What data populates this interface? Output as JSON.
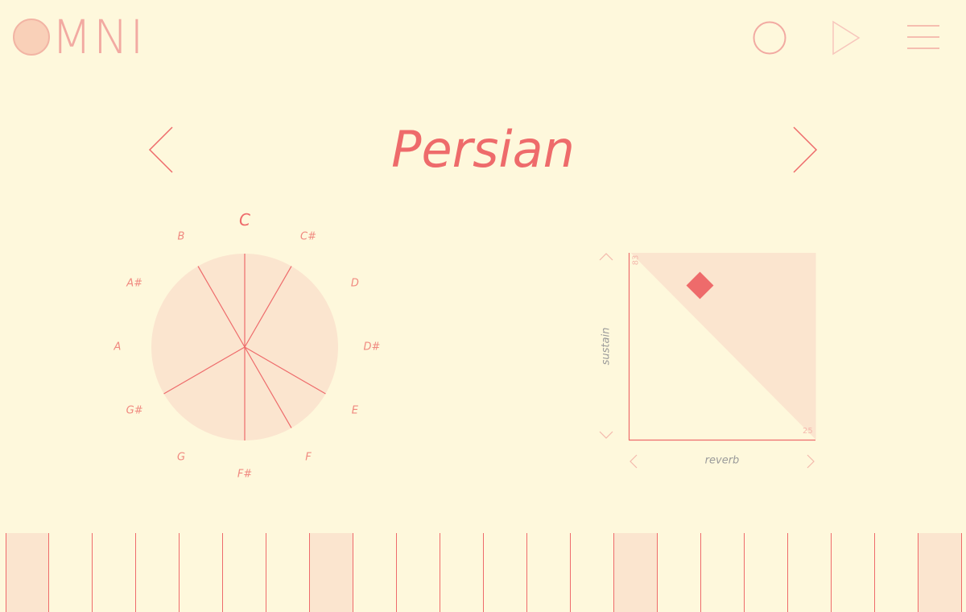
{
  "app": {
    "logo_text": "MNI"
  },
  "header": {
    "buttons": [
      "record-button",
      "play-button",
      "menu-button"
    ]
  },
  "scale": {
    "name": "Persian"
  },
  "circle": {
    "notes": [
      "C",
      "C#",
      "D",
      "D#",
      "E",
      "F",
      "F#",
      "G",
      "G#",
      "A",
      "A#",
      "B"
    ],
    "selected_notes": [
      "C",
      "C#",
      "E",
      "F",
      "F#",
      "G#",
      "B"
    ],
    "root": "C"
  },
  "pad": {
    "y_label": "sustain",
    "x_label": "reverb",
    "y_value": "83",
    "x_value": "25",
    "handle": {
      "x": 25,
      "y": 83
    }
  },
  "keyboard": {
    "key_count": 22,
    "root_keys": [
      0,
      7,
      14,
      21
    ]
  },
  "colors": {
    "background": "#fef8dc",
    "accent": "#ee6b6b",
    "fill": "#fbe5cf",
    "muted": "#f2aaa2"
  }
}
